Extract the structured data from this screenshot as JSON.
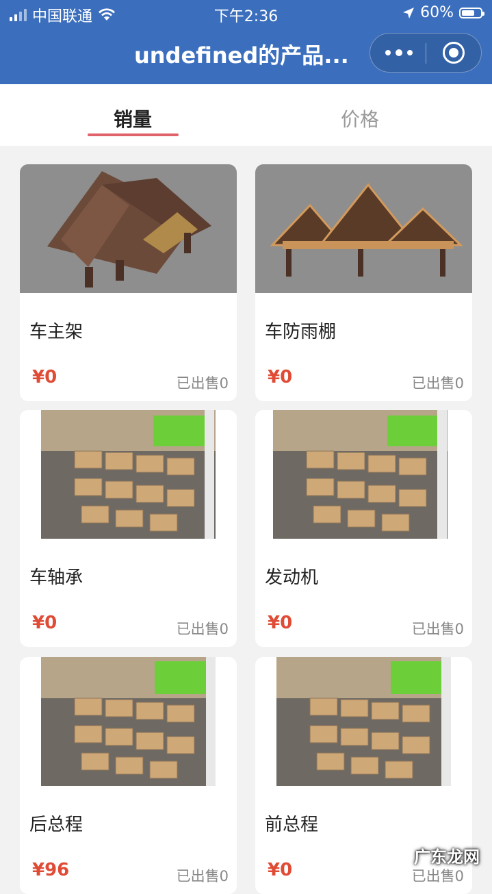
{
  "status": {
    "carrier": "中国联通",
    "time": "下午2:36",
    "battery": "60%"
  },
  "nav": {
    "title": "undefined的产品..."
  },
  "tabs": [
    {
      "label": "销量",
      "active": true
    },
    {
      "label": "价格",
      "active": false
    }
  ],
  "products": [
    {
      "name": "车主架",
      "price": "¥0",
      "sold": "已出售0",
      "image": "roof-frame"
    },
    {
      "name": "车防雨棚",
      "price": "¥0",
      "sold": "已出售0",
      "image": "roof-canopy"
    },
    {
      "name": "车轴承",
      "price": "¥0",
      "sold": "已出售0",
      "image": "warehouse"
    },
    {
      "name": "发动机",
      "price": "¥0",
      "sold": "已出售0",
      "image": "warehouse"
    },
    {
      "name": "后总程",
      "price": "¥96",
      "sold": "已出售0",
      "image": "warehouse"
    },
    {
      "name": "前总程",
      "price": "¥0",
      "sold": "已出售0",
      "image": "warehouse"
    }
  ],
  "watermark": "广东龙网",
  "colors": {
    "header": "#3b6fbd",
    "accent": "#e0636b",
    "price": "#e04b36"
  }
}
